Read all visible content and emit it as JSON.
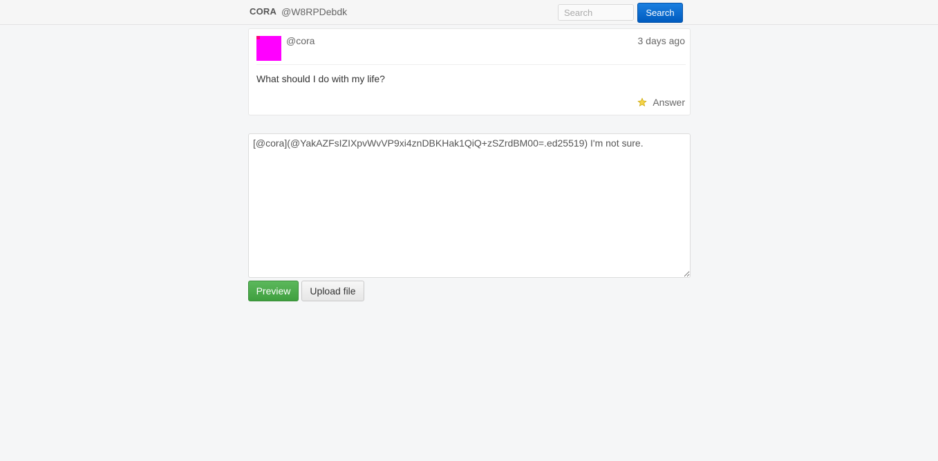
{
  "header": {
    "brand": "CORA",
    "user_handle": "@W8RPDebdk",
    "search_placeholder": "Search",
    "search_button": "Search"
  },
  "post": {
    "author": "@cora",
    "timestamp": "3 days ago",
    "body": "What should I do with my life?",
    "answer_label": "Answer",
    "avatar_icon": "identicon-avatar"
  },
  "reply": {
    "value": "[@cora](@YakAZFsIZIXpvWvVP9xi4znDBKHak1QiQ+zSZrdBM00=.ed25519) I'm not sure."
  },
  "actions": {
    "preview_label": "Preview",
    "upload_label": "Upload file"
  },
  "colors": {
    "primary": "#0d6fd0",
    "success": "#4cae4c",
    "star": "#f5c518"
  }
}
